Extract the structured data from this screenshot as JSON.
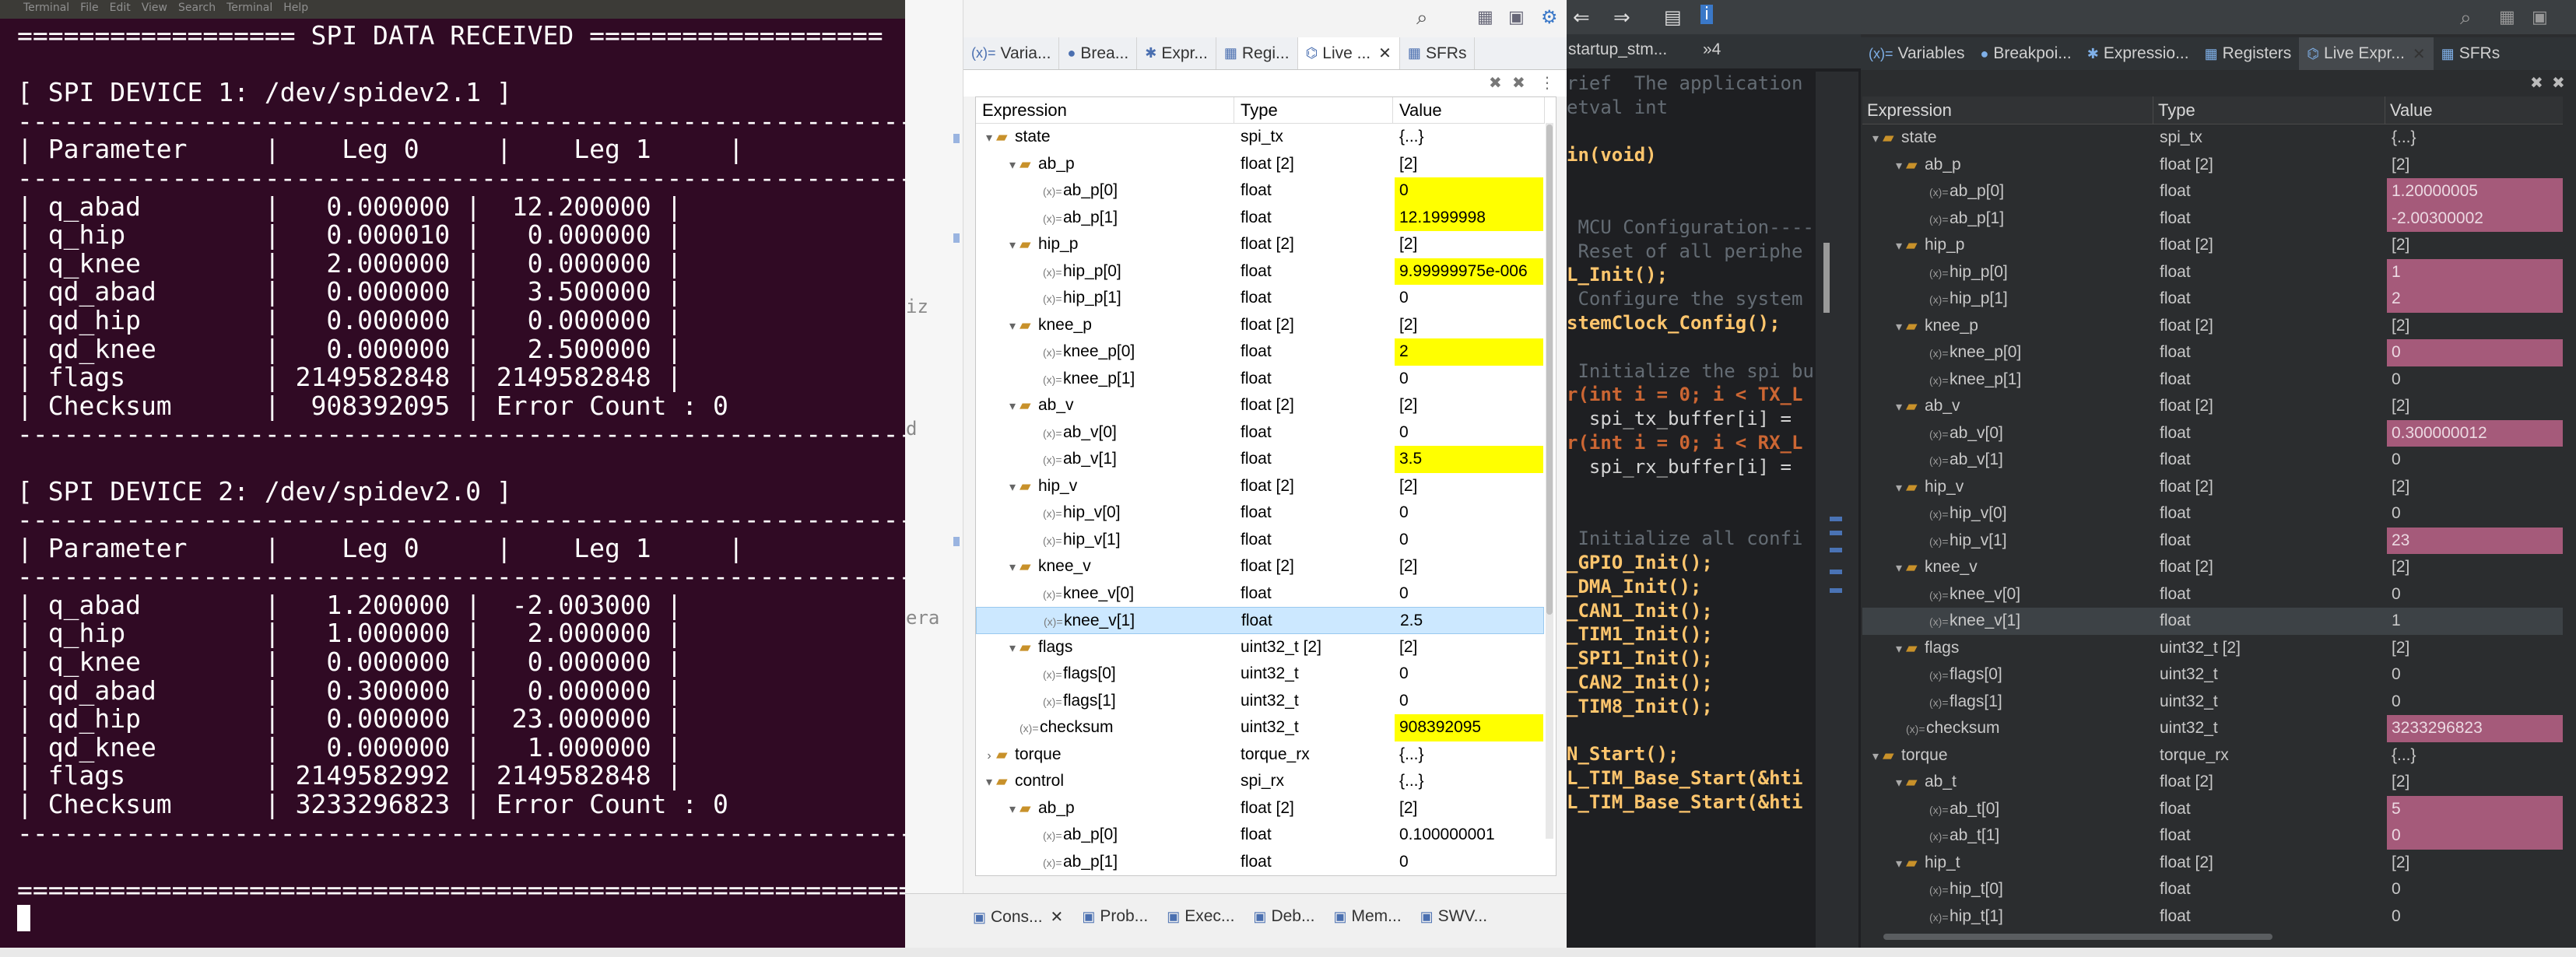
{
  "terminal": {
    "menu": [
      "Terminal",
      "File",
      "Edit",
      "View",
      "Search",
      "Terminal",
      "Help"
    ],
    "lines": [
      "================== SPI DATA RECEIVED ===================",
      "",
      "[ SPI DEVICE 1: /dev/spidev2.1 ]",
      "---------------------------------------------------------------",
      "| Parameter     |    Leg 0     |    Leg 1     |",
      "---------------------------------------------------------------",
      "| q_abad        |   0.000000 |  12.200000 |",
      "| q_hip         |   0.000010 |   0.000000 |",
      "| q_knee        |   2.000000 |   0.000000 |",
      "| qd_abad       |   0.000000 |   3.500000 |",
      "| qd_hip        |   0.000000 |   0.000000 |",
      "| qd_knee       |   0.000000 |   2.500000 |",
      "| flags         | 2149582848 | 2149582848 |",
      "| Checksum      |  908392095 | Error Count : 0",
      "---------------------------------------------------------------",
      "",
      "[ SPI DEVICE 2: /dev/spidev2.0 ]",
      "---------------------------------------------------------------",
      "| Parameter     |    Leg 0     |    Leg 1     |",
      "---------------------------------------------------------------",
      "| q_abad        |   1.200000 |  -2.003000 |",
      "| q_hip         |   1.000000 |   2.000000 |",
      "| q_knee        |   0.000000 |   0.000000 |",
      "| qd_abad       |   0.300000 |   0.000000 |",
      "| qd_hip        |   0.000000 |  23.000000 |",
      "| qd_knee       |   0.000000 |   1.000000 |",
      "| flags         | 2149582992 | 2149582848 |",
      "| Checksum      | 3233296823 | Error Count : 0",
      "---------------------------------------------------------------",
      "",
      "==============================================================="
    ]
  },
  "center": {
    "left_fragments": [
      "iz",
      "d",
      "era"
    ],
    "tabs": [
      {
        "icon": "(x)=",
        "label": "Varia..."
      },
      {
        "icon": "●",
        "label": "Brea..."
      },
      {
        "icon": "✱",
        "label": "Expr..."
      },
      {
        "icon": "▦",
        "label": "Regi..."
      },
      {
        "icon": "⌬",
        "label": "Live ..."
      },
      {
        "icon": "▦",
        "label": "SFRs"
      }
    ],
    "columns": [
      "Expression",
      "Type",
      "Value"
    ],
    "rows": [
      {
        "d": 0,
        "tw": "▾",
        "ic": "folder",
        "name": "state",
        "type": "spi_tx",
        "value": "{...}",
        "hl": false
      },
      {
        "d": 1,
        "tw": "▾",
        "ic": "folder",
        "name": "ab_p",
        "type": "float [2]",
        "value": "[2]",
        "hl": false
      },
      {
        "d": 2,
        "tw": "",
        "ic": "var",
        "name": "ab_p[0]",
        "type": "float",
        "value": "0",
        "hl": true
      },
      {
        "d": 2,
        "tw": "",
        "ic": "var",
        "name": "ab_p[1]",
        "type": "float",
        "value": "12.1999998",
        "hl": true
      },
      {
        "d": 1,
        "tw": "▾",
        "ic": "folder",
        "name": "hip_p",
        "type": "float [2]",
        "value": "[2]",
        "hl": false
      },
      {
        "d": 2,
        "tw": "",
        "ic": "var",
        "name": "hip_p[0]",
        "type": "float",
        "value": "9.99999975e-006",
        "hl": true
      },
      {
        "d": 2,
        "tw": "",
        "ic": "var",
        "name": "hip_p[1]",
        "type": "float",
        "value": "0",
        "hl": false
      },
      {
        "d": 1,
        "tw": "▾",
        "ic": "folder",
        "name": "knee_p",
        "type": "float [2]",
        "value": "[2]",
        "hl": false
      },
      {
        "d": 2,
        "tw": "",
        "ic": "var",
        "name": "knee_p[0]",
        "type": "float",
        "value": "2",
        "hl": true
      },
      {
        "d": 2,
        "tw": "",
        "ic": "var",
        "name": "knee_p[1]",
        "type": "float",
        "value": "0",
        "hl": false
      },
      {
        "d": 1,
        "tw": "▾",
        "ic": "folder",
        "name": "ab_v",
        "type": "float [2]",
        "value": "[2]",
        "hl": false
      },
      {
        "d": 2,
        "tw": "",
        "ic": "var",
        "name": "ab_v[0]",
        "type": "float",
        "value": "0",
        "hl": false
      },
      {
        "d": 2,
        "tw": "",
        "ic": "var",
        "name": "ab_v[1]",
        "type": "float",
        "value": "3.5",
        "hl": true
      },
      {
        "d": 1,
        "tw": "▾",
        "ic": "folder",
        "name": "hip_v",
        "type": "float [2]",
        "value": "[2]",
        "hl": false
      },
      {
        "d": 2,
        "tw": "",
        "ic": "var",
        "name": "hip_v[0]",
        "type": "float",
        "value": "0",
        "hl": false
      },
      {
        "d": 2,
        "tw": "",
        "ic": "var",
        "name": "hip_v[1]",
        "type": "float",
        "value": "0",
        "hl": false
      },
      {
        "d": 1,
        "tw": "▾",
        "ic": "folder",
        "name": "knee_v",
        "type": "float [2]",
        "value": "[2]",
        "hl": false
      },
      {
        "d": 2,
        "tw": "",
        "ic": "var",
        "name": "knee_v[0]",
        "type": "float",
        "value": "0",
        "hl": false
      },
      {
        "d": 2,
        "tw": "",
        "ic": "var",
        "name": "knee_v[1]",
        "type": "float",
        "value": "2.5",
        "hl": false,
        "sel": true
      },
      {
        "d": 1,
        "tw": "▾",
        "ic": "folder",
        "name": "flags",
        "type": "uint32_t [2]",
        "value": "[2]",
        "hl": false
      },
      {
        "d": 2,
        "tw": "",
        "ic": "var",
        "name": "flags[0]",
        "type": "uint32_t",
        "value": "0",
        "hl": false
      },
      {
        "d": 2,
        "tw": "",
        "ic": "var",
        "name": "flags[1]",
        "type": "uint32_t",
        "value": "0",
        "hl": false
      },
      {
        "d": 1,
        "tw": "",
        "ic": "var",
        "name": "checksum",
        "type": "uint32_t",
        "value": "908392095",
        "hl": true
      },
      {
        "d": 0,
        "tw": "›",
        "ic": "folder",
        "name": "torque",
        "type": "torque_rx",
        "value": "{...}",
        "hl": false
      },
      {
        "d": 0,
        "tw": "▾",
        "ic": "folder",
        "name": "control",
        "type": "spi_rx",
        "value": "{...}",
        "hl": false
      },
      {
        "d": 1,
        "tw": "▾",
        "ic": "folder",
        "name": "ab_p",
        "type": "float [2]",
        "value": "[2]",
        "hl": false
      },
      {
        "d": 2,
        "tw": "",
        "ic": "var",
        "name": "ab_p[0]",
        "type": "float",
        "value": "0.100000001",
        "hl": false
      },
      {
        "d": 2,
        "tw": "",
        "ic": "var",
        "name": "ab_p[1]",
        "type": "float",
        "value": "0",
        "hl": false
      }
    ],
    "bottom_tabs": [
      {
        "icon": "▣",
        "label": "Cons..."
      },
      {
        "icon": "▣",
        "label": "Prob..."
      },
      {
        "icon": "▣",
        "label": "Exec..."
      },
      {
        "icon": "▣",
        "label": "Deb..."
      },
      {
        "icon": "▣",
        "label": "Mem..."
      },
      {
        "icon": "▣",
        "label": "SWV..."
      }
    ]
  },
  "code": {
    "tabs": [
      "startup_stm...",
      "»4"
    ],
    "lines": [
      {
        "c": "cm",
        "t": "rief  The application"
      },
      {
        "c": "cm",
        "t": "etval int"
      },
      {
        "c": "tx",
        "t": ""
      },
      {
        "c": "fn",
        "t": "in(void)"
      },
      {
        "c": "tx",
        "t": ""
      },
      {
        "c": "tx",
        "t": ""
      },
      {
        "c": "cm",
        "t": " MCU Configuration----"
      },
      {
        "c": "cm",
        "t": " Reset of all periphe"
      },
      {
        "c": "fn",
        "t": "L_Init();"
      },
      {
        "c": "cm",
        "t": " Configure the system"
      },
      {
        "c": "fn",
        "t": "stemClock_Config();"
      },
      {
        "c": "tx",
        "t": ""
      },
      {
        "c": "cm",
        "t": " Initialize the spi bu"
      },
      {
        "c": "kw",
        "t": "r(int i = 0; i < TX_L"
      },
      {
        "c": "tx",
        "t": "  spi_tx_buffer[i] ="
      },
      {
        "c": "kw",
        "t": "r(int i = 0; i < RX_L"
      },
      {
        "c": "tx",
        "t": "  spi_rx_buffer[i] ="
      },
      {
        "c": "tx",
        "t": ""
      },
      {
        "c": "tx",
        "t": ""
      },
      {
        "c": "cm",
        "t": " Initialize all confi"
      },
      {
        "c": "fn",
        "t": "_GPIO_Init();"
      },
      {
        "c": "fn",
        "t": "_DMA_Init();"
      },
      {
        "c": "fn",
        "t": "_CAN1_Init();"
      },
      {
        "c": "fn",
        "t": "_TIM1_Init();"
      },
      {
        "c": "fn",
        "t": "_SPI1_Init();"
      },
      {
        "c": "fn",
        "t": "_CAN2_Init();"
      },
      {
        "c": "fn",
        "t": "_TIM8_Init();"
      },
      {
        "c": "tx",
        "t": ""
      },
      {
        "c": "fn",
        "t": "N_Start();"
      },
      {
        "c": "fn",
        "t": "L_TIM_Base_Start(&hti"
      },
      {
        "c": "fn",
        "t": "L_TIM_Base_Start(&hti"
      }
    ]
  },
  "right": {
    "tabs": [
      {
        "icon": "(x)=",
        "label": "Variables"
      },
      {
        "icon": "●",
        "label": "Breakpoi..."
      },
      {
        "icon": "✱",
        "label": "Expressio..."
      },
      {
        "icon": "▦",
        "label": "Registers"
      },
      {
        "icon": "⌬",
        "label": "Live Expr..."
      },
      {
        "icon": "▦",
        "label": "SFRs"
      }
    ],
    "columns": [
      "Expression",
      "Type",
      "Value"
    ],
    "rows": [
      {
        "d": 0,
        "tw": "▾",
        "ic": "folder",
        "name": "state",
        "type": "spi_tx",
        "value": "{...}",
        "hl": false
      },
      {
        "d": 1,
        "tw": "▾",
        "ic": "folder",
        "name": "ab_p",
        "type": "float [2]",
        "value": "[2]",
        "hl": false
      },
      {
        "d": 2,
        "tw": "",
        "ic": "var",
        "name": "ab_p[0]",
        "type": "float",
        "value": "1.20000005",
        "hl": true
      },
      {
        "d": 2,
        "tw": "",
        "ic": "var",
        "name": "ab_p[1]",
        "type": "float",
        "value": "-2.00300002",
        "hl": true
      },
      {
        "d": 1,
        "tw": "▾",
        "ic": "folder",
        "name": "hip_p",
        "type": "float [2]",
        "value": "[2]",
        "hl": false
      },
      {
        "d": 2,
        "tw": "",
        "ic": "var",
        "name": "hip_p[0]",
        "type": "float",
        "value": "1",
        "hl": true
      },
      {
        "d": 2,
        "tw": "",
        "ic": "var",
        "name": "hip_p[1]",
        "type": "float",
        "value": "2",
        "hl": true
      },
      {
        "d": 1,
        "tw": "▾",
        "ic": "folder",
        "name": "knee_p",
        "type": "float [2]",
        "value": "[2]",
        "hl": false
      },
      {
        "d": 2,
        "tw": "",
        "ic": "var",
        "name": "knee_p[0]",
        "type": "float",
        "value": "0",
        "hl": true
      },
      {
        "d": 2,
        "tw": "",
        "ic": "var",
        "name": "knee_p[1]",
        "type": "float",
        "value": "0",
        "hl": false
      },
      {
        "d": 1,
        "tw": "▾",
        "ic": "folder",
        "name": "ab_v",
        "type": "float [2]",
        "value": "[2]",
        "hl": false
      },
      {
        "d": 2,
        "tw": "",
        "ic": "var",
        "name": "ab_v[0]",
        "type": "float",
        "value": "0.300000012",
        "hl": true
      },
      {
        "d": 2,
        "tw": "",
        "ic": "var",
        "name": "ab_v[1]",
        "type": "float",
        "value": "0",
        "hl": false
      },
      {
        "d": 1,
        "tw": "▾",
        "ic": "folder",
        "name": "hip_v",
        "type": "float [2]",
        "value": "[2]",
        "hl": false
      },
      {
        "d": 2,
        "tw": "",
        "ic": "var",
        "name": "hip_v[0]",
        "type": "float",
        "value": "0",
        "hl": false
      },
      {
        "d": 2,
        "tw": "",
        "ic": "var",
        "name": "hip_v[1]",
        "type": "float",
        "value": "23",
        "hl": true
      },
      {
        "d": 1,
        "tw": "▾",
        "ic": "folder",
        "name": "knee_v",
        "type": "float [2]",
        "value": "[2]",
        "hl": false
      },
      {
        "d": 2,
        "tw": "",
        "ic": "var",
        "name": "knee_v[0]",
        "type": "float",
        "value": "0",
        "hl": false
      },
      {
        "d": 2,
        "tw": "",
        "ic": "var",
        "name": "knee_v[1]",
        "type": "float",
        "value": "1",
        "hl": false,
        "sel": true
      },
      {
        "d": 1,
        "tw": "▾",
        "ic": "folder",
        "name": "flags",
        "type": "uint32_t [2]",
        "value": "[2]",
        "hl": false
      },
      {
        "d": 2,
        "tw": "",
        "ic": "var",
        "name": "flags[0]",
        "type": "uint32_t",
        "value": "0",
        "hl": false
      },
      {
        "d": 2,
        "tw": "",
        "ic": "var",
        "name": "flags[1]",
        "type": "uint32_t",
        "value": "0",
        "hl": false
      },
      {
        "d": 1,
        "tw": "",
        "ic": "var",
        "name": "checksum",
        "type": "uint32_t",
        "value": "3233296823",
        "hl": true
      },
      {
        "d": 0,
        "tw": "▾",
        "ic": "folder",
        "name": "torque",
        "type": "torque_rx",
        "value": "{...}",
        "hl": false
      },
      {
        "d": 1,
        "tw": "▾",
        "ic": "folder",
        "name": "ab_t",
        "type": "float [2]",
        "value": "[2]",
        "hl": false
      },
      {
        "d": 2,
        "tw": "",
        "ic": "var",
        "name": "ab_t[0]",
        "type": "float",
        "value": "5",
        "hl": true
      },
      {
        "d": 2,
        "tw": "",
        "ic": "var",
        "name": "ab_t[1]",
        "type": "float",
        "value": "0",
        "hl": true
      },
      {
        "d": 1,
        "tw": "▾",
        "ic": "folder",
        "name": "hip_t",
        "type": "float [2]",
        "value": "[2]",
        "hl": false
      },
      {
        "d": 2,
        "tw": "",
        "ic": "var",
        "name": "hip_t[0]",
        "type": "float",
        "value": "0",
        "hl": false
      },
      {
        "d": 2,
        "tw": "",
        "ic": "var",
        "name": "hip_t[1]",
        "type": "float",
        "value": "0",
        "hl": false
      }
    ]
  }
}
